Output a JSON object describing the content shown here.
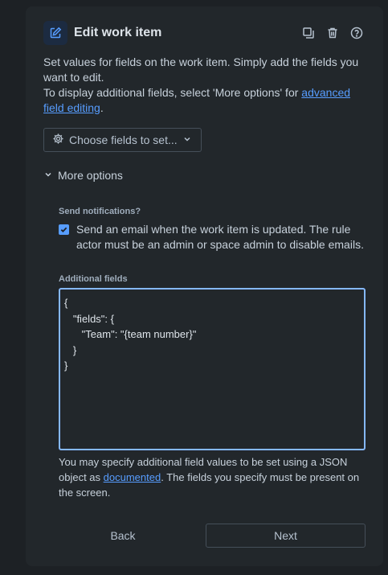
{
  "header": {
    "title": "Edit work item",
    "title_icon": "edit-icon",
    "actions": [
      "copy-icon",
      "trash-icon",
      "help-icon"
    ]
  },
  "description": {
    "line1": "Set values for fields on the work item. Simply add the fields you want to edit.",
    "line2_prefix": "To display additional fields, select 'More options' for ",
    "line2_link": "advanced field editing",
    "line2_suffix": "."
  },
  "choose_fields": {
    "label": "Choose fields to set..."
  },
  "more_options": {
    "label": "More options"
  },
  "notifications": {
    "label": "Send notifications?",
    "checked": true,
    "text": "Send an email when the work item is updated. The rule actor must be an admin or space admin to disable emails."
  },
  "additional_fields": {
    "label": "Additional fields",
    "value": "{\n   \"fields\": {\n      \"Team\": \"{team number}\"\n   }\n}",
    "helper_prefix": "You may specify additional field values to be set using a JSON object as ",
    "helper_link": "documented",
    "helper_suffix": ". The fields you specify must be present on the screen."
  },
  "footer": {
    "back_label": "Back",
    "next_label": "Next"
  },
  "colors": {
    "accent": "#579dff",
    "focus_border": "#85b8ff",
    "panel": "#22272b",
    "page": "#1d2125"
  }
}
